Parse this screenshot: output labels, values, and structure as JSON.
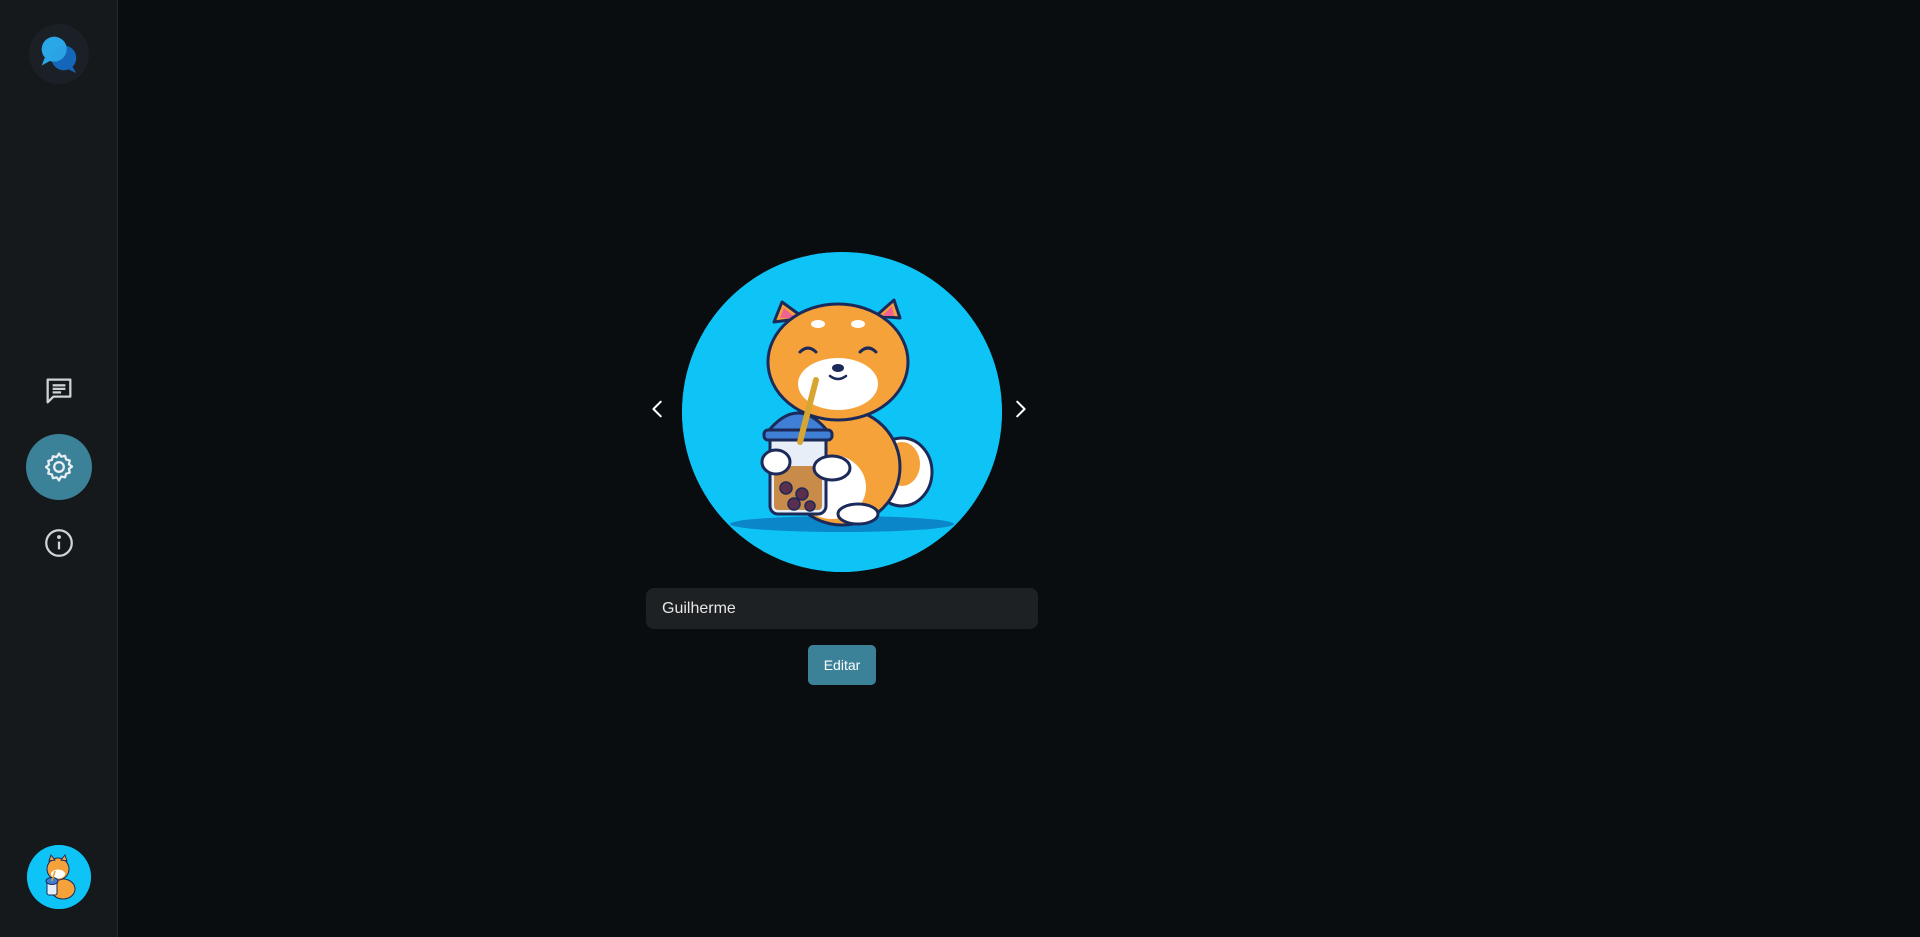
{
  "sidebar": {
    "logo_icon": "chat-bubbles-logo",
    "items": [
      {
        "icon": "chat-icon",
        "active": false
      },
      {
        "icon": "gear-icon",
        "active": true
      },
      {
        "icon": "info-icon",
        "active": false
      }
    ],
    "user_avatar_icon": "shiba-avatar"
  },
  "profile": {
    "picture_icon": "shiba-bubble-tea-avatar",
    "prev_icon": "chevron-left-icon",
    "next_icon": "chevron-right-icon",
    "name_value": "Guilherme",
    "edit_label": "Editar"
  },
  "colors": {
    "background": "#0a0d10",
    "sidebar": "#15191c",
    "accent": "#3b8299",
    "avatar_bg": "#0ec3f6",
    "input_bg": "#1e2124"
  }
}
